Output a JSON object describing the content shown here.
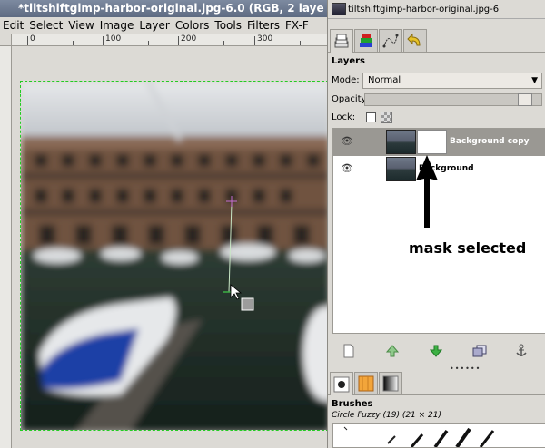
{
  "image_window": {
    "title": "*tiltshiftgimp-harbor-original.jpg-6.0 (RGB, 2 laye",
    "menus": [
      {
        "label": "Edit"
      },
      {
        "label": "Select"
      },
      {
        "label": "View"
      },
      {
        "label": "Image"
      },
      {
        "label": "Layer"
      },
      {
        "label": "Colors"
      },
      {
        "label": "Tools"
      },
      {
        "label": "Filters"
      },
      {
        "label": "FX-F"
      }
    ],
    "ruler_labels": [
      "0",
      "100",
      "200",
      "300"
    ]
  },
  "dock": {
    "title": "tiltshiftgimp-harbor-original.jpg-6",
    "tabs": [
      {
        "icon": "layers-icon"
      },
      {
        "icon": "channels-icon"
      },
      {
        "icon": "paths-icon"
      },
      {
        "icon": "undo-history-icon"
      }
    ],
    "layers_header": "Layers",
    "mode_label": "Mode:",
    "mode_value": "Normal",
    "opacity_label": "Opacity:",
    "lock_label": "Lock:",
    "layers": [
      {
        "name": "Background copy",
        "selected": true,
        "has_mask": true
      },
      {
        "name": "Background",
        "selected": false,
        "has_mask": false
      }
    ],
    "annotation": "mask selected",
    "layer_buttons": [
      {
        "icon": "new-layer-icon"
      },
      {
        "icon": "raise-layer-icon"
      },
      {
        "icon": "lower-layer-icon"
      },
      {
        "icon": "duplicate-layer-icon"
      },
      {
        "icon": "anchor-layer-icon"
      }
    ],
    "brushes_header": "Brushes",
    "brush_name": "Circle Fuzzy (19) (21 × 21)"
  },
  "colors": {
    "accent_green": "#3cb043",
    "selected_row": "#9a9893",
    "annotation_arrow": "#000000"
  }
}
